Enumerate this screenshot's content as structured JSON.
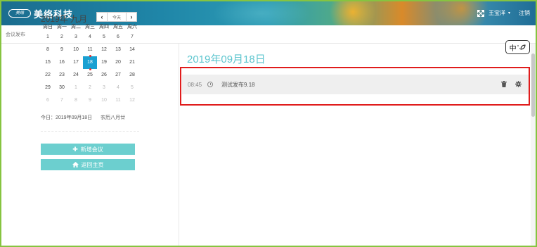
{
  "header": {
    "logo_badge": "美络",
    "brand": "美络科技",
    "user": "王宝洋",
    "user_caret": "▾",
    "logout": "注销"
  },
  "breadcrumb": "会议发布",
  "calendar": {
    "title": "2019年  九月",
    "prev": "‹",
    "today_button": "今天",
    "next": "›",
    "weekdays": [
      "周日",
      "周一",
      "周二",
      "周三",
      "周四",
      "周五",
      "周六"
    ],
    "weeks": [
      [
        {
          "d": "1"
        },
        {
          "d": "2"
        },
        {
          "d": "3"
        },
        {
          "d": "4"
        },
        {
          "d": "5"
        },
        {
          "d": "6"
        },
        {
          "d": "7"
        }
      ],
      [
        {
          "d": "8"
        },
        {
          "d": "9"
        },
        {
          "d": "10"
        },
        {
          "d": "11"
        },
        {
          "d": "12"
        },
        {
          "d": "13"
        },
        {
          "d": "14"
        }
      ],
      [
        {
          "d": "15"
        },
        {
          "d": "16"
        },
        {
          "d": "17"
        },
        {
          "d": "18",
          "selected": true
        },
        {
          "d": "19"
        },
        {
          "d": "20"
        },
        {
          "d": "21"
        }
      ],
      [
        {
          "d": "22"
        },
        {
          "d": "23"
        },
        {
          "d": "24"
        },
        {
          "d": "25"
        },
        {
          "d": "26"
        },
        {
          "d": "27"
        },
        {
          "d": "28"
        }
      ],
      [
        {
          "d": "29"
        },
        {
          "d": "30"
        },
        {
          "d": "1",
          "other": true
        },
        {
          "d": "2",
          "other": true
        },
        {
          "d": "3",
          "other": true
        },
        {
          "d": "4",
          "other": true
        },
        {
          "d": "5",
          "other": true
        }
      ],
      [
        {
          "d": "6",
          "other": true
        },
        {
          "d": "7",
          "other": true
        },
        {
          "d": "8",
          "other": true
        },
        {
          "d": "9",
          "other": true
        },
        {
          "d": "10",
          "other": true
        },
        {
          "d": "11",
          "other": true
        },
        {
          "d": "12",
          "other": true
        }
      ]
    ],
    "today_text": "今日：2019年09月18日",
    "lunar_text": "农历八月廿"
  },
  "buttons": {
    "add_meeting": "新增会议",
    "back_home": "返回主页"
  },
  "main": {
    "date_heading": "2019年09月18日",
    "meetings": [
      {
        "time": "08:45",
        "title": "测试发布9.18"
      }
    ]
  },
  "ime": {
    "main": "中",
    "sub": "°,"
  },
  "colors": {
    "accent": "#5ec6cf",
    "button": "#6ccfcf",
    "selected_day": "#1aa0d2",
    "highlight_box": "#e01c1c",
    "frame": "#86c440"
  }
}
